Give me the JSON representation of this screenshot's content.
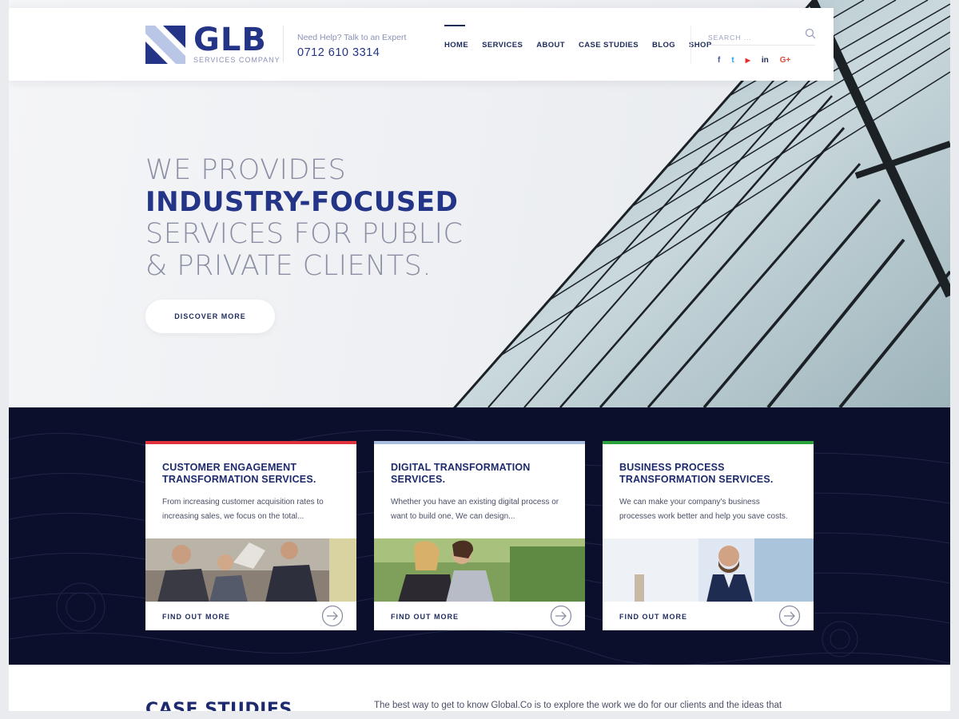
{
  "brand": {
    "name": "GLB",
    "tagline": "SERVICES COMPANY"
  },
  "contact": {
    "label": "Need Help? Talk to an Expert",
    "phone": "0712 610 3314"
  },
  "nav": {
    "items": [
      {
        "label": "HOME",
        "active": true
      },
      {
        "label": "SERVICES",
        "active": false
      },
      {
        "label": "ABOUT",
        "active": false
      },
      {
        "label": "CASE STUDIES",
        "active": false
      },
      {
        "label": "BLOG",
        "active": false
      },
      {
        "label": "SHOP",
        "active": false
      }
    ]
  },
  "search": {
    "placeholder": "SEARCH ..."
  },
  "social": [
    {
      "icon": "facebook-icon",
      "glyph": "f",
      "color": "#3b5998"
    },
    {
      "icon": "twitter-icon",
      "glyph": "t",
      "color": "#1da1f2"
    },
    {
      "icon": "youtube-icon",
      "glyph": "▶",
      "color": "#e52d27"
    },
    {
      "icon": "linkedin-icon",
      "glyph": "in",
      "color": "#1d2a5c"
    },
    {
      "icon": "google-plus-icon",
      "glyph": "G+",
      "color": "#dd4b39"
    }
  ],
  "hero": {
    "line1": "WE PROVIDES",
    "line2": "INDUSTRY-FOCUSED",
    "line3": "SERVICES FOR PUBLIC",
    "line4": "& PRIVATE CLIENTS.",
    "cta": "DISCOVER MORE"
  },
  "services": [
    {
      "title": "CUSTOMER ENGAGEMENT TRANSFORMATION SERVICES.",
      "description": "From increasing customer acquisition rates to increasing sales, we focus on the total...",
      "link": "FIND OUT MORE",
      "accent": "#e0323c"
    },
    {
      "title": "DIGITAL TRANSFORMATION SERVICES.",
      "description": "Whether you have an existing digital process or want to build one, We can design...",
      "link": "FIND OUT MORE",
      "accent": "#a9bde0"
    },
    {
      "title": "BUSINESS PROCESS TRANSFORMATION SERVICES.",
      "description": "We can make your company's business processes work better and help you save costs.",
      "link": "FIND OUT MORE",
      "accent": "#2aa13a"
    }
  ],
  "case_studies": {
    "title": "CASE STUDIES",
    "intro": "The best way to get to know Global.Co is to explore the work we do for our clients and the ideas that"
  },
  "colors": {
    "primary": "#243486",
    "band": "#0b0f2c",
    "text_light": "#8a8fa3"
  }
}
